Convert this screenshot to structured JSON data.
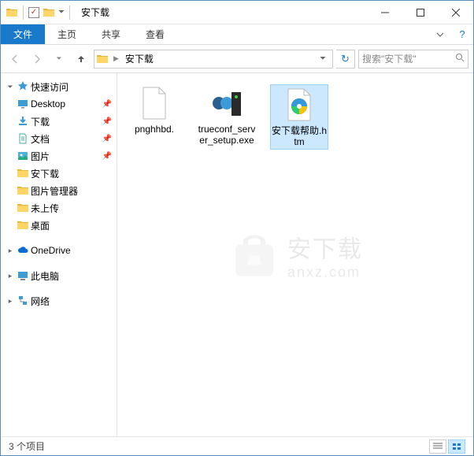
{
  "title": "安下载",
  "ribbon": {
    "file": "文件",
    "home": "主页",
    "share": "共享",
    "view": "查看"
  },
  "nav": {
    "breadcrumb": "安下载",
    "search_placeholder": "搜索\"安下载\""
  },
  "sidebar": {
    "quick": "快速访问",
    "items": [
      {
        "label": "Desktop"
      },
      {
        "label": "下载"
      },
      {
        "label": "文档"
      },
      {
        "label": "图片"
      },
      {
        "label": "安下载"
      },
      {
        "label": "图片管理器"
      },
      {
        "label": "未上传"
      },
      {
        "label": "桌面"
      }
    ],
    "onedrive": "OneDrive",
    "thispc": "此电脑",
    "network": "网络"
  },
  "files": [
    {
      "name": "pnghhbd."
    },
    {
      "name": "trueconf_server_setup.exe"
    },
    {
      "name": "安下载帮助.htm"
    }
  ],
  "watermark": {
    "top": "安下载",
    "bot": "anxz.com"
  },
  "status": "3 个项目"
}
